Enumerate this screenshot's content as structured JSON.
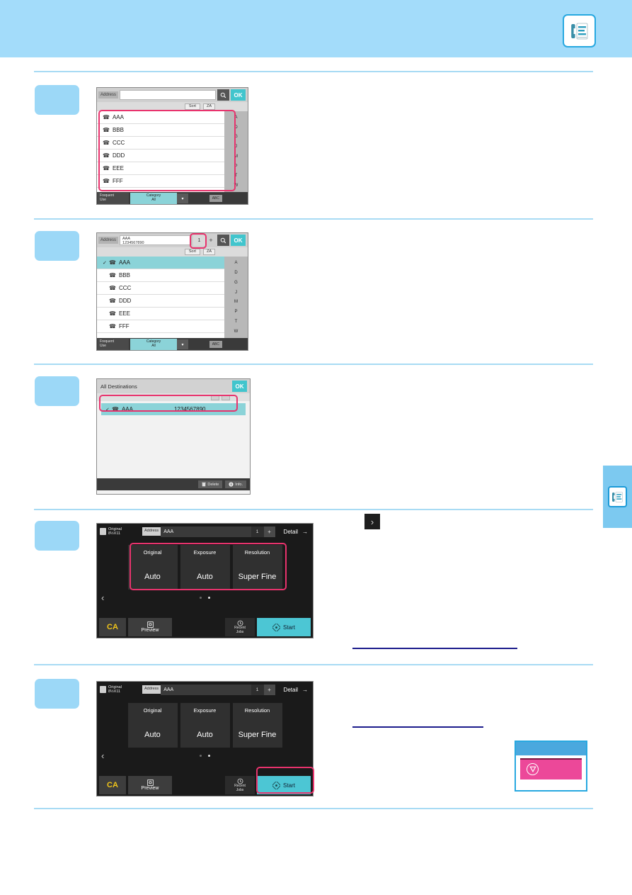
{
  "page": {
    "header_icon": "fax-addressbook-icon",
    "side_tab_icon": "fax-addressbook-icon"
  },
  "steps": [
    {
      "badge": ""
    },
    {
      "badge": ""
    },
    {
      "badge": ""
    },
    {
      "badge": ""
    },
    {
      "badge": ""
    }
  ],
  "screen1": {
    "address_label": "Address",
    "address_value": "",
    "search_icon": "search-icon",
    "ok_label": "OK",
    "sort_label": "Sort",
    "sort_order_label": "ZA",
    "rows": [
      {
        "name": "AAA",
        "icon": "phone-icon",
        "selected": false
      },
      {
        "name": "BBB",
        "icon": "phone-icon",
        "selected": false
      },
      {
        "name": "CCC",
        "icon": "phone-icon",
        "selected": false
      },
      {
        "name": "DDD",
        "icon": "phone-icon",
        "selected": false
      },
      {
        "name": "EEE",
        "icon": "phone-icon",
        "selected": false
      },
      {
        "name": "FFF",
        "icon": "phone-icon",
        "selected": false
      }
    ],
    "index_letters": [
      "A",
      "D",
      "G",
      "J",
      "M",
      "P",
      "T",
      "W"
    ],
    "frequent_use_label": "Frequent\nUse",
    "frequent_use_line1": "Frequent",
    "frequent_use_line2": "Use",
    "category_line1": "Category",
    "category_line2": "All",
    "dropdown_icon": "chevron-down-icon",
    "abc_label": "ABC"
  },
  "screen2": {
    "address_label": "Address",
    "address_name": "AAA",
    "address_number": "1234567890",
    "count": "1",
    "plus_label": "+",
    "search_icon": "search-icon",
    "ok_label": "OK",
    "sort_label": "Sort",
    "sort_order_label": "ZA",
    "rows": [
      {
        "name": "AAA",
        "icon": "phone-icon",
        "selected": true
      },
      {
        "name": "BBB",
        "icon": "phone-icon",
        "selected": false
      },
      {
        "name": "CCC",
        "icon": "phone-icon",
        "selected": false
      },
      {
        "name": "DDD",
        "icon": "phone-icon",
        "selected": false
      },
      {
        "name": "EEE",
        "icon": "phone-icon",
        "selected": false
      },
      {
        "name": "FFF",
        "icon": "phone-icon",
        "selected": false
      }
    ],
    "index_letters": [
      "A",
      "D",
      "G",
      "J",
      "M",
      "P",
      "T",
      "W"
    ],
    "frequent_use_line1": "Frequent",
    "frequent_use_line2": "Use",
    "category_line1": "Category",
    "category_line2": "All",
    "dropdown_icon": "chevron-down-icon",
    "abc_label": "ABC"
  },
  "screen3": {
    "title": "All Destinations",
    "ok_label": "OK",
    "row": {
      "name": "AAA",
      "number": "1234567890",
      "icon": "phone-icon",
      "selected": true
    },
    "delete_label": "Delete",
    "delete_icon": "trash-icon",
    "info_label": "Info.",
    "info_icon": "info-icon"
  },
  "screen4": {
    "original_label": "Original",
    "original_size": "8½X11",
    "original_icon": "document-icon",
    "address_label": "Address",
    "address_value": "AAA",
    "count": "1",
    "plus_label": "+",
    "detail_label": "Detail",
    "detail_arrow": "arrow-right-icon",
    "tiles": [
      {
        "label": "Original",
        "value": "Auto"
      },
      {
        "label": "Exposure",
        "value": "Auto"
      },
      {
        "label": "Resolution",
        "value": "Super Fine"
      }
    ],
    "prev_icon": "chevron-left-icon",
    "page_dots": 2,
    "active_dot": 1,
    "ca_label": "CA",
    "preview_label": "Preview",
    "preview_icon": "preview-icon",
    "recent_jobs_line1": "Recent",
    "recent_jobs_line2": "Jobs",
    "recent_jobs_icon": "history-icon",
    "start_label": "Start",
    "start_icon": "start-icon"
  },
  "screen5": {
    "original_label": "Original",
    "original_size": "8½X11",
    "original_icon": "document-icon",
    "address_label": "Address",
    "address_value": "AAA",
    "count": "1",
    "plus_label": "+",
    "detail_label": "Detail",
    "detail_arrow": "arrow-right-icon",
    "tiles": [
      {
        "label": "Original",
        "value": "Auto"
      },
      {
        "label": "Exposure",
        "value": "Auto"
      },
      {
        "label": "Resolution",
        "value": "Super Fine"
      }
    ],
    "prev_icon": "chevron-left-icon",
    "page_dots": 2,
    "active_dot": 1,
    "ca_label": "CA",
    "preview_label": "Preview",
    "preview_icon": "preview-icon",
    "recent_jobs_line1": "Recent",
    "recent_jobs_line2": "Jobs",
    "recent_jobs_icon": "history-icon",
    "start_label": "Start",
    "start_icon": "start-icon"
  },
  "annotations": {
    "chevron_right_icon": "chevron-right-icon",
    "stop_callout_icon": "stop-icon"
  },
  "colors": {
    "header_blue": "#a3dcfa",
    "accent_teal": "#41c5cd",
    "highlight_pink": "#e8336d",
    "stop_pink": "#ec4899",
    "rule_blue": "#1c1c8c"
  }
}
